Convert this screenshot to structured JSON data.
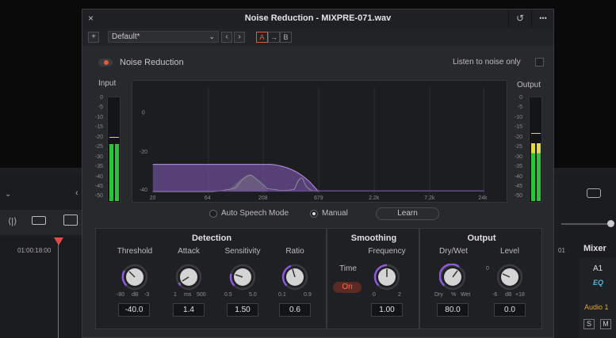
{
  "dialog": {
    "title": "Noise Reduction - MIXPRE-071.wav",
    "close_glyph": "×",
    "reset_glyph": "↺",
    "more_glyph": "•••"
  },
  "preset": {
    "add_glyph": "+",
    "name": "Default*",
    "prev_glyph": "‹",
    "next_glyph": "›",
    "a_label": "A",
    "arrow_glyph": "→",
    "b_label": "B"
  },
  "noise_reduction": {
    "label": "Noise Reduction",
    "enabled": true
  },
  "listen": {
    "label": "Listen to noise only",
    "checked": false
  },
  "input_meter": {
    "label": "Input",
    "scale": [
      "0",
      "-5",
      "-10",
      "-15",
      "-20",
      "-25",
      "-30",
      "-35",
      "-40",
      "-45",
      "-50"
    ],
    "level_left": 0.55,
    "level_right": 0.55
  },
  "output_meter": {
    "label": "Output",
    "scale": [
      "0",
      "-5",
      "-10",
      "-15",
      "-20",
      "-25",
      "-30",
      "-35",
      "-40",
      "-45",
      "-50"
    ],
    "level_left": 0.56,
    "level_right": 0.56
  },
  "graph": {
    "y_labels": [
      "0",
      "-20",
      "-40"
    ],
    "x_labels": [
      "20",
      "64",
      "208",
      "679",
      "2.2k",
      "7.2k",
      "24k"
    ]
  },
  "mode": {
    "auto_label": "Auto Speech Mode",
    "manual_label": "Manual",
    "selected": "Manual",
    "learn_label": "Learn"
  },
  "detection": {
    "title": "Detection",
    "threshold": {
      "label": "Threshold",
      "min": "-80",
      "unit": "dB",
      "max": "-3",
      "value": "-40.0"
    },
    "attack": {
      "label": "Attack",
      "min": "1",
      "unit": "ms",
      "max": "500",
      "value": "1.4"
    },
    "sensitivity": {
      "label": "Sensitivity",
      "min": "0.5",
      "max": "5.0",
      "value": "1.50"
    },
    "ratio": {
      "label": "Ratio",
      "min": "0.1",
      "max": "0.9",
      "value": "0.6"
    }
  },
  "smoothing": {
    "title": "Smoothing",
    "time_label": "Time",
    "on_label": "On",
    "frequency": {
      "label": "Frequency",
      "min": "0",
      "max": "2",
      "value": "1.00"
    }
  },
  "output": {
    "title": "Output",
    "drywet": {
      "label": "Dry/Wet",
      "min": "Dry",
      "unit": "%",
      "max": "Wet",
      "value": "80.0"
    },
    "level": {
      "label": "Level",
      "zero": "0",
      "min": "-6",
      "unit": "dB",
      "max": "+18",
      "value": "0.0"
    }
  },
  "background": {
    "timecode": "01:00:18:00",
    "mixer_label": "Mixer",
    "track_a1": "A1",
    "eq_label": "EQ",
    "audio1_label": "Audio 1",
    "solo_label": "S",
    "mute_label": "M",
    "ruler_mark": "01"
  },
  "colors": {
    "accent_red": "#e25a3a",
    "meter_green": "#2fc13a",
    "meter_yellow": "#e3d84a",
    "knob_purple": "#8c5ad8",
    "graph_purple": "#6b4c93"
  }
}
